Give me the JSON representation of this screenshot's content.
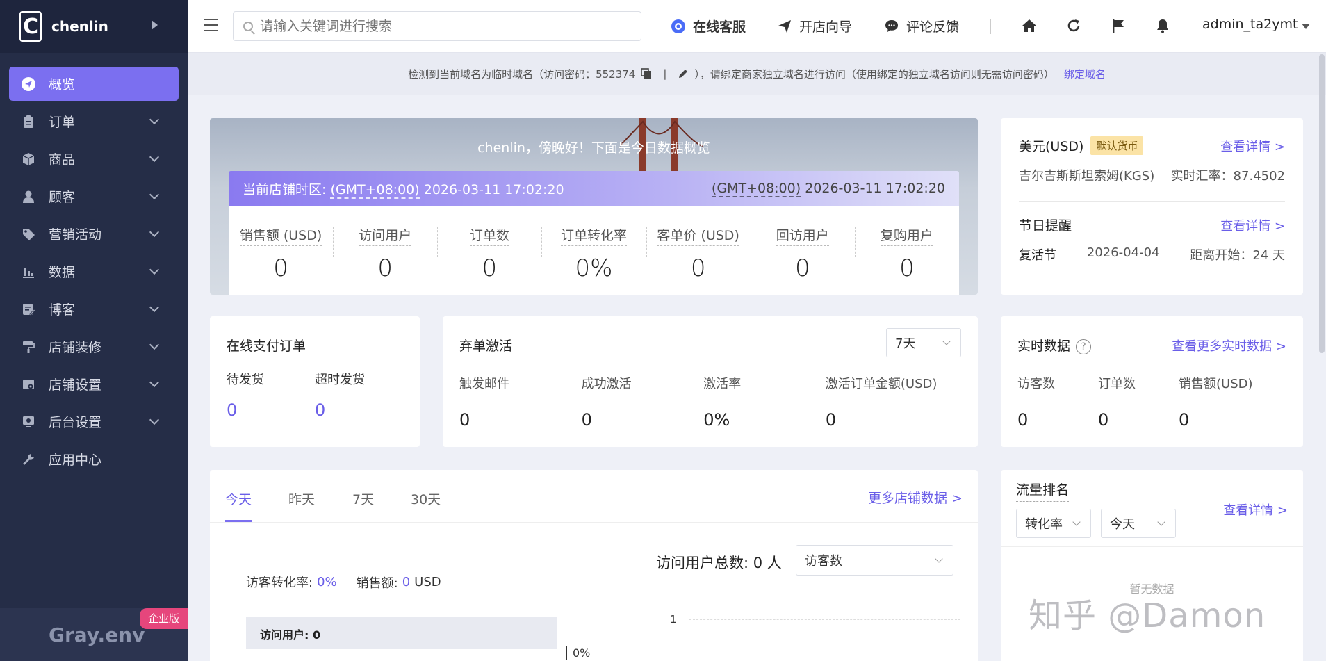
{
  "brand": {
    "letter": "C",
    "name": "chenlin"
  },
  "sidebar": {
    "items": [
      {
        "label": "概览",
        "icon": "send-icon",
        "active": true
      },
      {
        "label": "订单",
        "icon": "clipboard-icon"
      },
      {
        "label": "商品",
        "icon": "box-icon"
      },
      {
        "label": "顾客",
        "icon": "user-icon"
      },
      {
        "label": "营销活动",
        "icon": "tag-icon"
      },
      {
        "label": "数据",
        "icon": "bar-chart-icon"
      },
      {
        "label": "博客",
        "icon": "edit-doc-icon"
      },
      {
        "label": "店铺装修",
        "icon": "paint-roller-icon"
      },
      {
        "label": "店铺设置",
        "icon": "store-settings-icon"
      },
      {
        "label": "后台设置",
        "icon": "admin-settings-icon"
      },
      {
        "label": "应用中心",
        "icon": "wrench-icon"
      }
    ],
    "footer_text": "Gray.env",
    "edition_badge": "企业版"
  },
  "header": {
    "search_placeholder": "请输入关键词进行搜索",
    "online_service": "在线客服",
    "setup_guide": "开店向导",
    "feedback": "评论反馈",
    "username": "admin_ta2ymt"
  },
  "notice": {
    "text_before": "检测到当前域名为临时域名（访问密码：552374",
    "sep": "|",
    "text_after": "），请绑定商家独立域名进行访问（使用绑定的独立域名访问则无需访问密码）",
    "link": "绑定域名"
  },
  "hero": {
    "greeting": "chenlin，傍晚好！下面是今日数据概览",
    "tz_label": "当前店铺时区:",
    "tz_value": "(GMT+08:00)",
    "tz_time": "2026-03-11 17:02:20",
    "local_tz": "(GMT+08:00)",
    "local_time": "2026-03-11 17:02:20",
    "stats": [
      {
        "label": "销售额 (USD)",
        "value": "0"
      },
      {
        "label": "访问用户",
        "value": "0"
      },
      {
        "label": "订单数",
        "value": "0"
      },
      {
        "label": "订单转化率",
        "value": "0%"
      },
      {
        "label": "客单价 (USD)",
        "value": "0"
      },
      {
        "label": "回访用户",
        "value": "0"
      },
      {
        "label": "复购用户",
        "value": "0"
      }
    ]
  },
  "currency": {
    "title": "美元(USD)",
    "badge": "默认货币",
    "detail": "查看详情 >",
    "secondary": "吉尔吉斯斯坦索姆(KGS)",
    "rate": "实时汇率：87.4502",
    "holiday_title": "节日提醒",
    "holiday_detail": "查看详情 >",
    "holiday_name": "复活节",
    "holiday_date": "2026-04-04",
    "holiday_countdown": "距离开始：24 天"
  },
  "pay": {
    "title": "在线支付订单",
    "labels": [
      "待发货",
      "超时发货"
    ],
    "values": [
      "0",
      "0"
    ]
  },
  "abandon": {
    "title": "弃单激活",
    "range": "7天",
    "labels": [
      "触发邮件",
      "成功激活",
      "激活率",
      "激活订单金额(USD)"
    ],
    "values": [
      "0",
      "0",
      "0%",
      "0"
    ]
  },
  "realtime": {
    "title": "实时数据",
    "more": "查看更多实时数据 >",
    "labels": [
      "访客数",
      "订单数",
      "销售额(USD)"
    ],
    "values": [
      "0",
      "0",
      "0"
    ]
  },
  "traffic": {
    "tabs": [
      "今天",
      "昨天",
      "7天",
      "30天"
    ],
    "more": "更多店铺数据 >",
    "conv_label": "访客转化率:",
    "conv_value": "0%",
    "sales_label": "销售额:",
    "sales_value": "0",
    "sales_unit": "USD",
    "total_label": "访问用户总数:",
    "total_value": "0 人",
    "metric_select": "访客数",
    "visit_box": "访问用户: 0",
    "pct": "0%",
    "axis_one": "1"
  },
  "rank": {
    "title": "流量排名",
    "detail": "查看详情 >",
    "select1": "转化率",
    "select2": "今天",
    "nodata": "暂无数据"
  },
  "watermark": "知乎 @Damon",
  "colors": {
    "accent": "#7b6ff0",
    "sidebar": "#252d47",
    "badge": "#e6467c"
  }
}
